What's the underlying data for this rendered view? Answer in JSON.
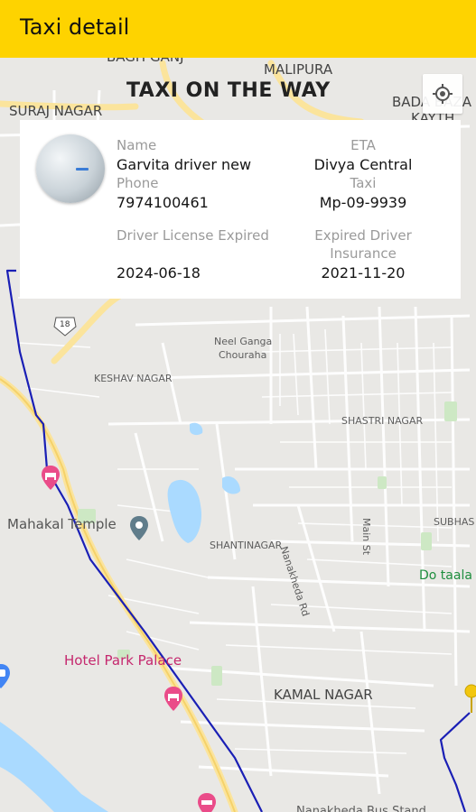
{
  "app_bar": {
    "title": "Taxi detail"
  },
  "status_banner": "TAXI ON THE WAY",
  "driver": {
    "name_label": "Name",
    "name": "Garvita driver new",
    "phone_label": "Phone",
    "phone": "7974100461",
    "license_label": "Driver License Expired",
    "license_expiry": "2024-06-18"
  },
  "trip": {
    "eta_label": "ETA",
    "eta_value": "Divya Central",
    "taxi_label": "Taxi",
    "taxi_number": "Mp-09-9939",
    "insurance_label_line1": "Expired Driver",
    "insurance_label_line2": "Insurance",
    "insurance_expiry": "2021-11-20"
  },
  "map": {
    "labels": {
      "bagh_ganj": "BAGH GANJ",
      "malipura": "MALIPURA",
      "bada_bazar": "BADA BAZA",
      "kayth": "KAYTH",
      "suraj_nagar": "SURAJ NAGAR",
      "route_18": "18",
      "neel_ganga_1": "Neel Ganga",
      "neel_ganga_2": "Chouraha",
      "keshav_nagar": "KESHAV NAGAR",
      "shastri_nagar": "SHASTRI NAGAR",
      "mahakal_temple": "Mahakal Temple",
      "shantinagar": "SHANTINAGAR",
      "nanakheda_rd": "Nanakheda Rd",
      "main_st": "Main St",
      "subhas": "SUBHAS",
      "do_taalab": "Do taala",
      "hotel_park_palace": "Hotel Park Palace",
      "kamal_nagar": "KAMAL NAGAR",
      "bus_stand": "Nanakheda Bus Stand"
    },
    "route_color": "#1a1fb5",
    "accent_color": "#fed300"
  }
}
